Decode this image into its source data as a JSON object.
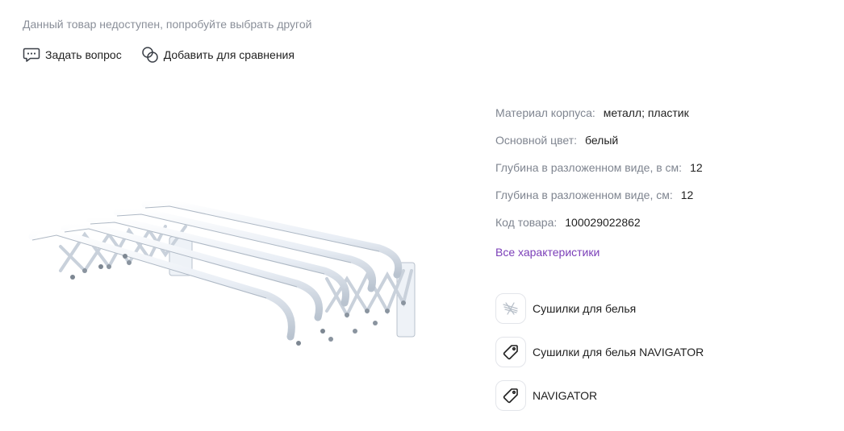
{
  "notice": "Данный товар недоступен, попробуйте выбрать другой",
  "actions": {
    "ask_question": {
      "label": "Задать вопрос",
      "icon": "chat-bubble-icon"
    },
    "compare": {
      "label": "Добавить для сравнения",
      "icon": "compare-circles-icon"
    }
  },
  "product_image": {
    "description_icon": "clothes-dryer-rack-image"
  },
  "specs": [
    {
      "key": "Материал корпуса:",
      "value": "металл; пластик"
    },
    {
      "key": "Основной цвет:",
      "value": "белый"
    },
    {
      "key": "Глубина в разложенном виде, в см:",
      "value": "12"
    },
    {
      "key": "Глубина в разложенном виде, см:",
      "value": "12"
    },
    {
      "key": "Код товара:",
      "value": "100029022862"
    }
  ],
  "all_specs_link": "Все характеристики",
  "categories": [
    {
      "label": "Сушилки для белья",
      "icon": "dryer-thumbnail-icon"
    },
    {
      "label": "Сушилки для белья NAVIGATOR",
      "icon": "tag-icon"
    },
    {
      "label": "NAVIGATOR",
      "icon": "tag-icon"
    }
  ],
  "colors": {
    "link": "#7b3fb8",
    "muted": "#7f8590",
    "text": "#1f1f1f",
    "border": "#e3e5ea"
  }
}
